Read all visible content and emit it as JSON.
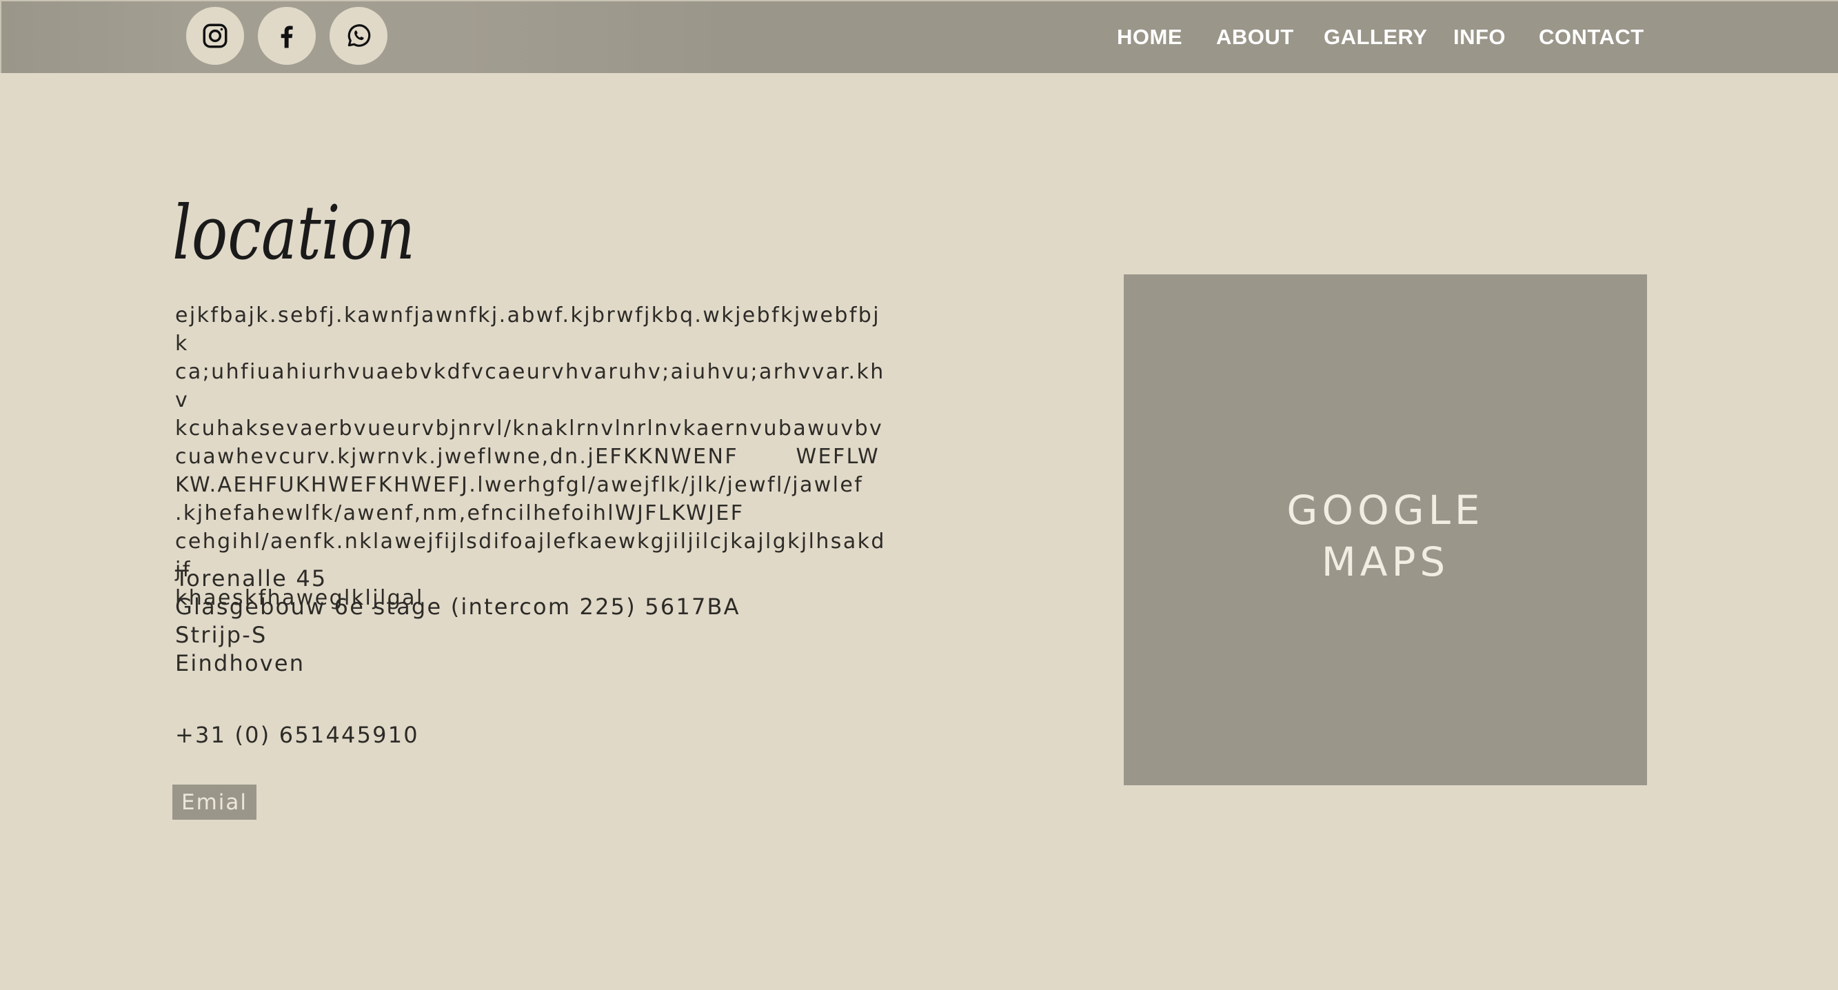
{
  "social": {
    "instagram": "instagram-icon",
    "facebook": "facebook-icon",
    "whatsapp": "whatsapp-icon"
  },
  "nav": {
    "items": [
      "HOME",
      "ABOUT",
      "GALLERY",
      "INFO",
      "CONTACT"
    ]
  },
  "location": {
    "heading": "location",
    "lines": [
      "ejkfbajk.sebfj.kawnfjawnfkj.abwf.kjbrwfjkbq.wkjebfkjwebfbjk",
      "ca;uhfiuahiurhvuaebvkdfvcaeurvhvaruhv;aiuhvu;arhvvar.khv",
      "kcuhaksevaerbvueurvbjnrvl/knaklrnvlnrlnvkaernvubawuvbv",
      "cuawhevcurv.kjwrnvk.jweflwne,dn.jEFKKNWENF       WEFLW",
      "KW.AEHFUKHWEFKHWEFJ.lwerhgfgl/awejflk/jlk/jewfl/jawlef",
      ".kjhefahewlfk/awenf,nm,efncilhefoihlWJFLKWJEF",
      "cehgihl/aenfk.nklawejfijlsdifoajlefkaewkgjiljilcjkajlgkjlhsakdjf",
      "khaeskfhaweglkljlgal"
    ],
    "address": {
      "street": "Torenalle 45",
      "building": "Glasgebouw 6e stage (intercom 225) 5617BA",
      "district": "Strijp-S",
      "city": "Eindhoven"
    },
    "phone": "+31 (0) 651445910",
    "email_label": "Emial"
  },
  "map": {
    "line1": "GOOGLE",
    "line2": "MAPS"
  },
  "colors": {
    "background": "#e0d9c8",
    "bar": "#9a968a",
    "text": "#2d2b27"
  }
}
